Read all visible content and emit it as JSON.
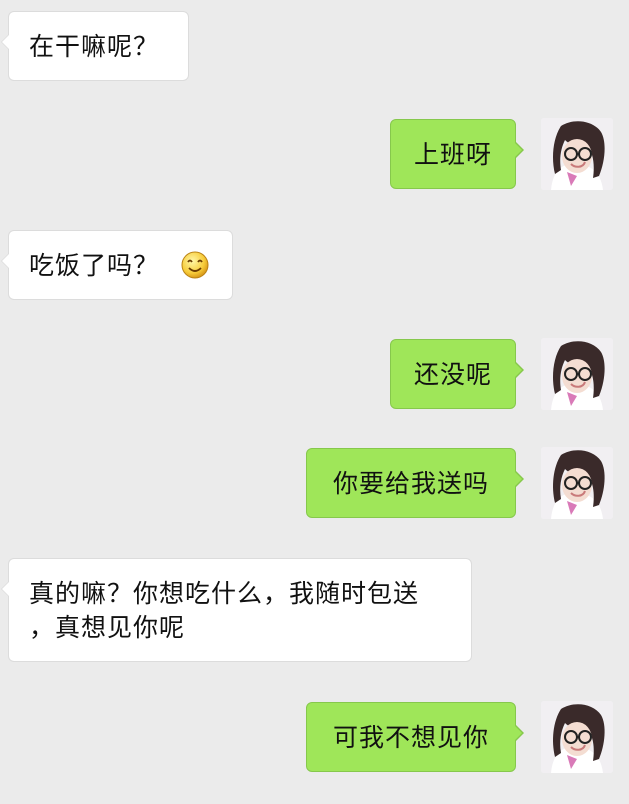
{
  "messages": [
    {
      "side": "in",
      "text": "在干嘛呢？"
    },
    {
      "side": "out",
      "text": "上班呀"
    },
    {
      "side": "in",
      "text": "吃饭了吗？",
      "emoji": "smile-emoji-icon"
    },
    {
      "side": "out",
      "text": "还没呢"
    },
    {
      "side": "out",
      "text": "你要给我送吗"
    },
    {
      "side": "in",
      "line1": "真的嘛？你想吃什么，我随时包送",
      "line2": "，真想见你呢"
    },
    {
      "side": "out",
      "text": "可我不想见你"
    }
  ],
  "colors": {
    "background": "#ebebeb",
    "incoming_bubble": "#ffffff",
    "outgoing_bubble": "#9fe659"
  },
  "icons": {
    "avatar": "user-avatar-photo",
    "emoji": "smile-emoji-icon"
  }
}
